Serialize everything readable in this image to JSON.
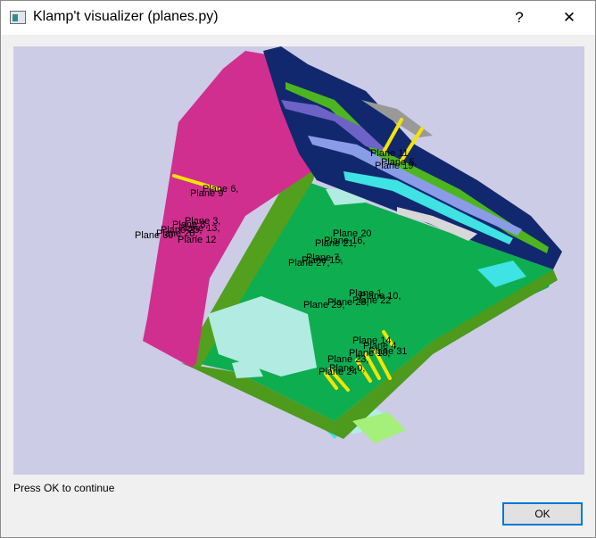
{
  "window": {
    "title": "Klamp't visualizer (planes.py)",
    "help_label": "?",
    "close_label": "✕"
  },
  "viewport": {
    "background": "#cccce6",
    "plane_labels": [
      "Plane 6,",
      "Plane 9",
      "Plane 3,",
      "Plane 8,",
      "Plane 13,",
      "Plane 25,",
      "Plane 30",
      "Plane 20,",
      "Plane 12",
      "Plane 20",
      "Plane 16,",
      "Plane 21,",
      "Plane 7,",
      "Plane 27,",
      "Plane 15,",
      "Plane 1,",
      "Plane 10,",
      "Plane 22",
      "Plane 29,",
      "Plane 28,",
      "Plane 14",
      "Plane 4,",
      "Plane 23,",
      "Plane 18,",
      "Plane 31",
      "Plane 0,",
      "Plane 24",
      "Plane 5,",
      "Plane 11",
      "Plane 19"
    ]
  },
  "status_text": "Press OK to continue",
  "ok_label": "OK"
}
